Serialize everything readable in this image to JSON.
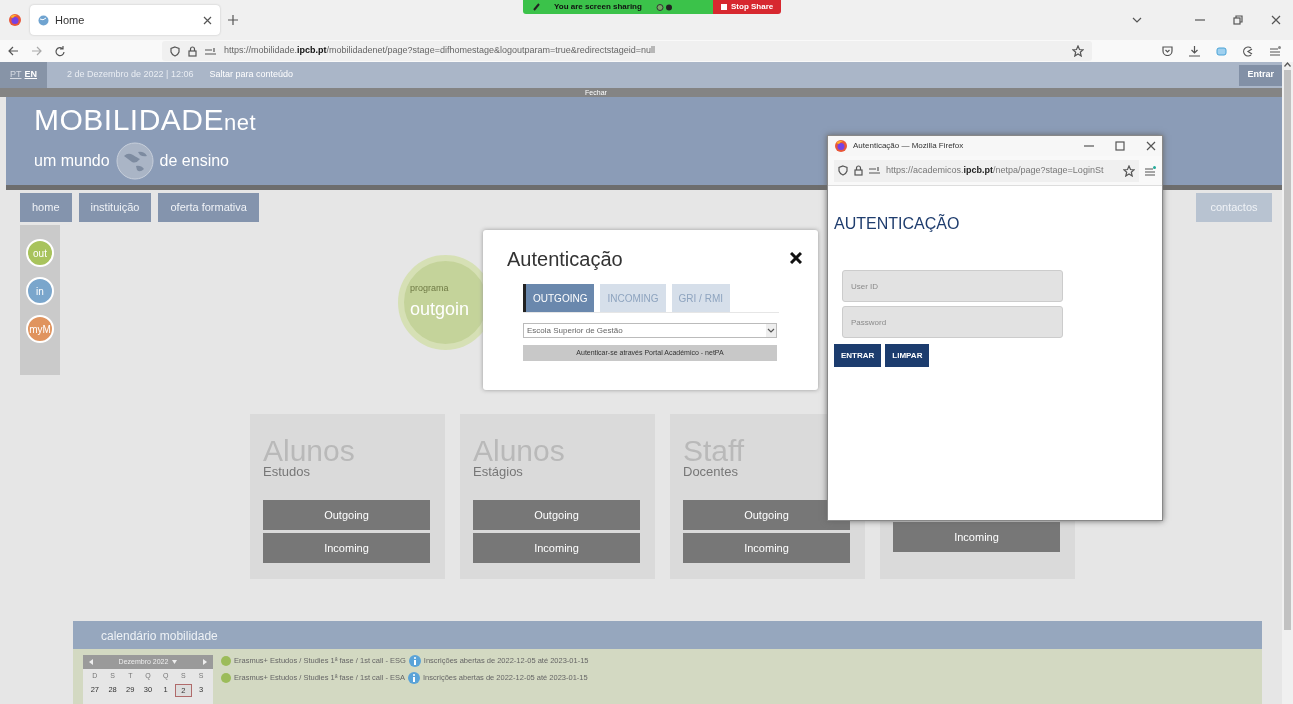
{
  "browser": {
    "tab": {
      "title": "Home",
      "selected": true
    },
    "url": {
      "prefix": "https://mobilidade.",
      "host": "ipcb.pt",
      "path": "/mobilidadenet/page?stage=difhomestage&logoutparam=true&redirectstageid=null"
    }
  },
  "screen_share": {
    "message": "You are screen sharing",
    "button": "Stop Share"
  },
  "top_bar": {
    "languages": [
      {
        "label": "PT",
        "selected": false
      },
      {
        "label": "EN",
        "selected": true
      }
    ],
    "date": "2 de Dezembro de 2022 | 12:06",
    "skip_link": "Saltar para conteúdo",
    "login": "Entrar",
    "close": "Fechar"
  },
  "header": {
    "logo_main": "MOBILIDADE",
    "logo_suffix": "net",
    "tagline_left": "um mundo",
    "tagline_right": "de ensino"
  },
  "nav": {
    "items": [
      "home",
      "instituição",
      "oferta formativa"
    ],
    "right": "contactos"
  },
  "side_icons": [
    {
      "label": "out",
      "color": "#a8c35c"
    },
    {
      "label": "in",
      "color": "#7aa6cc"
    },
    {
      "label": "myM",
      "color": "#e0945e"
    }
  ],
  "program_circle": {
    "caption": "programa",
    "label": "outgoin"
  },
  "cards": [
    {
      "title": "Alunos",
      "subtitle": "Estudos",
      "buttons": [
        "Outgoing",
        "Incoming"
      ]
    },
    {
      "title": "Alunos",
      "subtitle": "Estágios",
      "buttons": [
        "Outgoing",
        "Incoming"
      ]
    },
    {
      "title": "Staff",
      "subtitle": "Docentes",
      "buttons": [
        "Outgoing",
        "Incoming"
      ]
    },
    {
      "buttons": [
        "Incoming"
      ]
    }
  ],
  "modal": {
    "title": "Autenticação",
    "tabs": [
      {
        "label": "OUTGOING",
        "selected": true
      },
      {
        "label": "INCOMING",
        "selected": false
      },
      {
        "label": "GRI / RMI",
        "selected": false
      }
    ],
    "school": "Escola Superior de Gestão",
    "button": "Autenticar-se através Portal Académico - netPA"
  },
  "popup": {
    "title": "Autenticação — Mozilla Firefox",
    "url": {
      "prefix": "https://academicos.",
      "host": "ipcb.pt",
      "path": "/netpa/page?stage=LoginSt"
    },
    "heading": "AUTENTICAÇÃO",
    "fields": [
      {
        "placeholder": "User ID"
      },
      {
        "placeholder": "Password"
      }
    ],
    "buttons": [
      "ENTRAR",
      "LIMPAR"
    ]
  },
  "calendar": {
    "title": "calendário mobilidade",
    "month": "Dezembro 2022",
    "weekdays": [
      "D",
      "S",
      "T",
      "Q",
      "Q",
      "S",
      "S"
    ],
    "days": [
      {
        "label": "27",
        "selected": false
      },
      {
        "label": "28",
        "selected": false
      },
      {
        "label": "29",
        "selected": false
      },
      {
        "label": "30",
        "selected": false
      },
      {
        "label": "1",
        "selected": false
      },
      {
        "label": "2",
        "selected": true
      },
      {
        "label": "3",
        "selected": false
      }
    ],
    "events": [
      {
        "text": "Erasmus+ Estudos / Studies 1ª fase / 1st call - ESG",
        "note": "Inscrições abertas de 2022-12-05 até 2023-01-15"
      },
      {
        "text": "Erasmus+ Estudos / Studies 1ª fase / 1st call - ESA",
        "note": "Inscrições abertas de 2022-12-05 até 2023-01-15"
      }
    ]
  }
}
